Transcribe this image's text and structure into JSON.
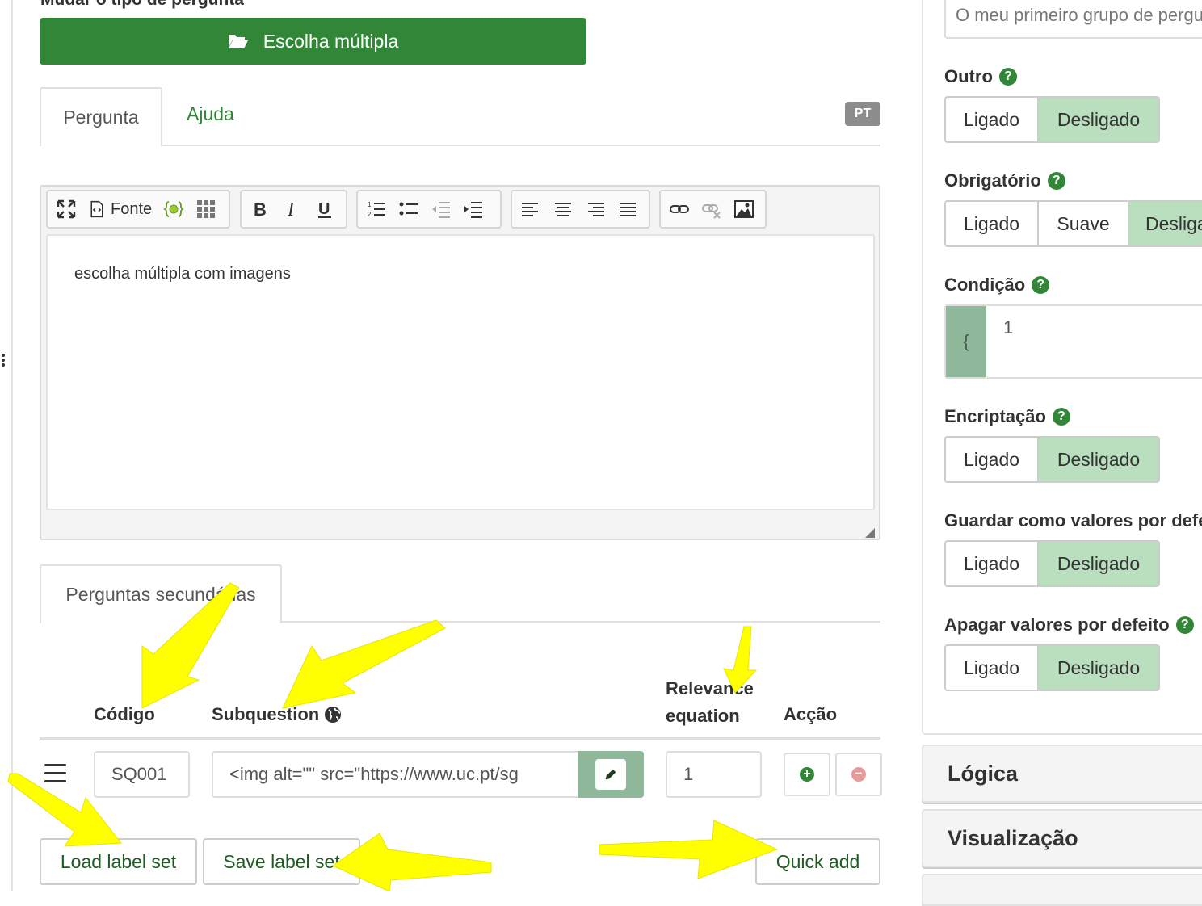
{
  "header": {
    "section_title": "Mudar o tipo de pergunta",
    "type_button_label": "Escolha múltipla"
  },
  "tabs": [
    {
      "label": "Pergunta"
    },
    {
      "label": "Ajuda"
    }
  ],
  "language_badge": "PT",
  "editor": {
    "toolbar": {
      "source_label": "Fonte"
    },
    "content": "escolha múltipla com imagens"
  },
  "subquestions": {
    "tab_label": "Perguntas secundárias",
    "columns": {
      "code": "Código",
      "subquestion": "Subquestion",
      "relevance": "Relevance equation",
      "action": "Acção"
    },
    "rows": [
      {
        "code": "SQ001",
        "subquestion": "<img alt=\"\" src=\"https://www.uc.pt/sg",
        "relevance": "1"
      }
    ],
    "buttons": {
      "load": "Load label set",
      "save": "Save label set",
      "quick_add": "Quick add"
    }
  },
  "settings": {
    "group_value": "O meu primeiro grupo de perguntas",
    "on_label": "Ligado",
    "off_label": "Desligado",
    "soft_label": "Suave",
    "other": {
      "label": "Outro"
    },
    "mandatory": {
      "label": "Obrigatório"
    },
    "condition": {
      "label": "Condição",
      "prefix": "{",
      "value": "1"
    },
    "encryption": {
      "label": "Encriptação"
    },
    "save_defaults": {
      "label": "Guardar como valores por defeito"
    },
    "clear_defaults": {
      "label": "Apagar valores por defeito"
    }
  },
  "accordion": [
    {
      "label": "Lógica"
    },
    {
      "label": "Visualização"
    }
  ],
  "colors": {
    "primary_green": "#328637",
    "toggle_on": "#b9dfbf",
    "addon_green": "#8fb79a",
    "annotation_yellow": "#ffff00"
  }
}
